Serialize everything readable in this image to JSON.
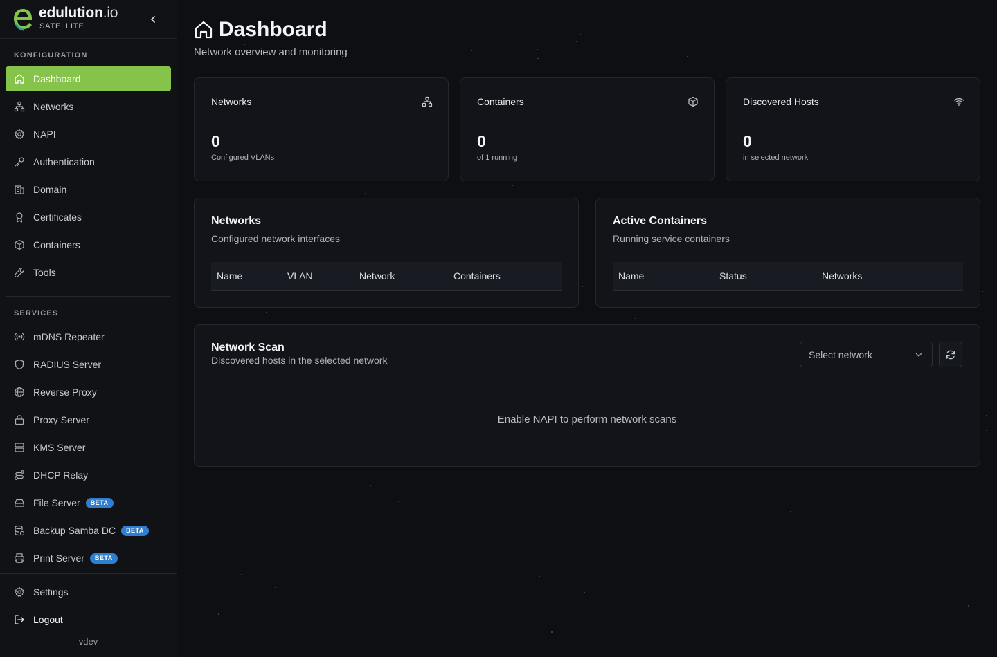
{
  "brand": {
    "name": "edulution",
    "tld": ".io",
    "subtitle": "SATELLITE"
  },
  "sidebar": {
    "config_label": "KONFIGURATION",
    "config_items": [
      {
        "label": "Dashboard",
        "icon": "home-icon",
        "active": true
      },
      {
        "label": "Networks",
        "icon": "network-icon"
      },
      {
        "label": "NAPI",
        "icon": "gear-icon"
      },
      {
        "label": "Authentication",
        "icon": "key-icon"
      },
      {
        "label": "Domain",
        "icon": "building-icon"
      },
      {
        "label": "Certificates",
        "icon": "award-icon"
      },
      {
        "label": "Containers",
        "icon": "box-icon"
      },
      {
        "label": "Tools",
        "icon": "wrench-icon"
      }
    ],
    "services_label": "SERVICES",
    "service_items": [
      {
        "label": "mDNS Repeater",
        "icon": "radio-icon"
      },
      {
        "label": "RADIUS Server",
        "icon": "shield-icon"
      },
      {
        "label": "Reverse Proxy",
        "icon": "globe-icon"
      },
      {
        "label": "Proxy Server",
        "icon": "lock-icon"
      },
      {
        "label": "KMS Server",
        "icon": "server-icon"
      },
      {
        "label": "DHCP Relay",
        "icon": "route-icon"
      },
      {
        "label": "File Server",
        "icon": "hard-drive-icon",
        "badge": "BETA"
      },
      {
        "label": "Backup Samba DC",
        "icon": "database-backup-icon",
        "badge": "BETA"
      },
      {
        "label": "Print Server",
        "icon": "printer-icon",
        "badge": "BETA"
      }
    ],
    "settings_label": "Settings",
    "logout_label": "Logout",
    "version": "vdev"
  },
  "header": {
    "title": "Dashboard",
    "subtitle": "Network overview and monitoring"
  },
  "stats": [
    {
      "title": "Networks",
      "value": "0",
      "caption": "Configured VLANs",
      "icon": "network-icon"
    },
    {
      "title": "Containers",
      "value": "0",
      "caption": "of 1 running",
      "icon": "box-icon"
    },
    {
      "title": "Discovered Hosts",
      "value": "0",
      "caption": "in selected network",
      "icon": "wifi-icon"
    }
  ],
  "networks_panel": {
    "title": "Networks",
    "subtitle": "Configured network interfaces",
    "columns": [
      "Name",
      "VLAN",
      "Network",
      "Containers"
    ]
  },
  "containers_panel": {
    "title": "Active Containers",
    "subtitle": "Running service containers",
    "columns": [
      "Name",
      "Status",
      "Networks"
    ]
  },
  "scan_panel": {
    "title": "Network Scan",
    "subtitle": "Discovered hosts in the selected network",
    "select_placeholder": "Select network",
    "empty_message": "Enable NAPI to perform network scans"
  },
  "colors": {
    "accent": "#86c34a",
    "badge": "#2f7fd0",
    "background": "#0d0f13"
  }
}
